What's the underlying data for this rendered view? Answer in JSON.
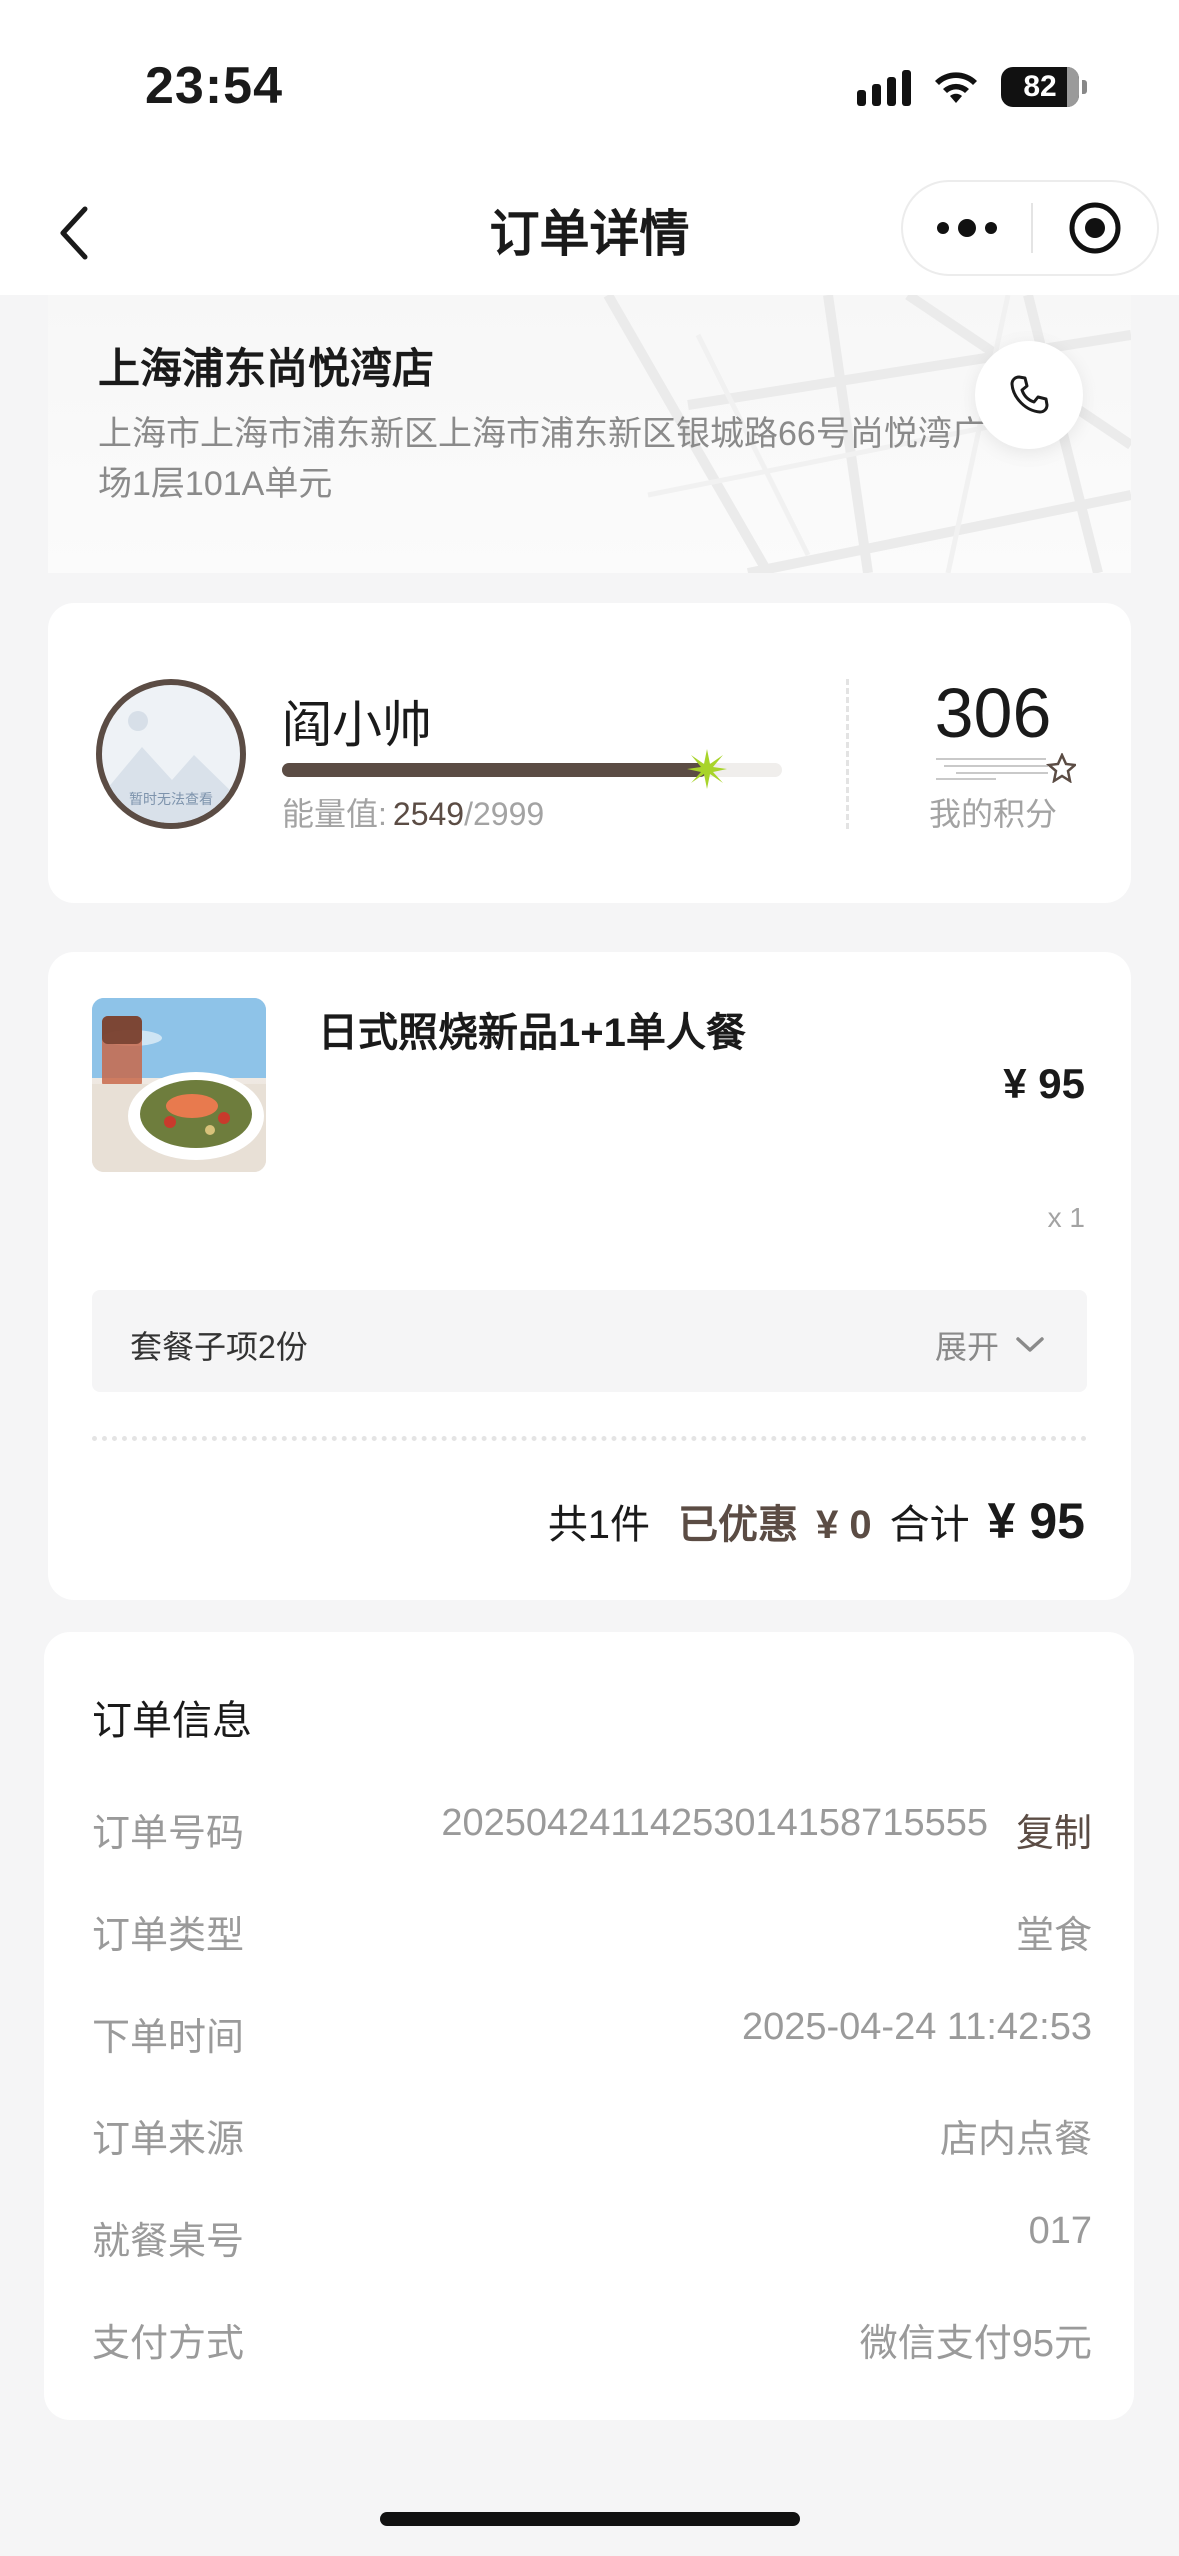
{
  "status_bar": {
    "time": "23:54",
    "battery": "82",
    "icons": [
      "signal-icon",
      "wifi-icon",
      "battery-icon"
    ]
  },
  "nav": {
    "title": "订单详情",
    "back_icon": "chevron-left-icon",
    "more_icon": "more-dots-icon",
    "close_icon": "target-close-icon"
  },
  "store": {
    "name": "上海浦东尚悦湾店",
    "address": "上海市上海市浦东新区上海市浦东新区银城路66号尚悦湾广场1层101A单元",
    "phone_icon": "phone-icon"
  },
  "member": {
    "name": "阎小帅",
    "avatar_placeholder": "暂时无法查看",
    "energy_label": "能量值:",
    "energy_current": "2549",
    "energy_max": "/2999",
    "energy_fraction": 0.85,
    "points": "306",
    "points_label": "我的积分"
  },
  "order_items": {
    "items": [
      {
        "name": "日式照烧新品1+1单人餐",
        "price": "¥ 95",
        "qty": "x 1"
      }
    ],
    "sub_items_label": "套餐子项2份",
    "expand_label": "展开",
    "summary": {
      "count": "共1件",
      "discount_label": "已优惠",
      "discount_value": "¥ 0",
      "total_label": "合计",
      "total_value": "¥ 95"
    }
  },
  "order_info": {
    "title": "订单信息",
    "copy_label": "复制",
    "rows": [
      {
        "label": "订单号码",
        "value": "20250424114253014158715555"
      },
      {
        "label": "订单类型",
        "value": "堂食"
      },
      {
        "label": "下单时间",
        "value": "2025-04-24 11:42:53"
      },
      {
        "label": "订单来源",
        "value": "店内点餐"
      },
      {
        "label": "就餐桌号",
        "value": "017"
      },
      {
        "label": "支付方式",
        "value": "微信支付95元"
      }
    ]
  },
  "colors": {
    "accent_brown": "#5b4c44",
    "star_green": "#a8d42a",
    "page_bg": "#f5f5f6"
  }
}
